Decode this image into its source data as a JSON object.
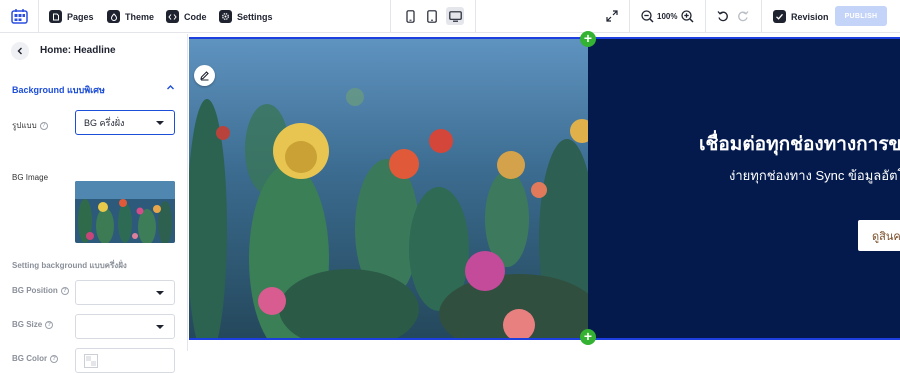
{
  "toolbar": {
    "pages_label": "Pages",
    "theme_label": "Theme",
    "code_label": "Code",
    "settings_label": "Settings",
    "zoom": "100%",
    "revision_label": "Revision",
    "publish_label": "PUBLISH",
    "icons": [
      "app-logo-icon",
      "pages-icon",
      "theme-icon",
      "code-icon",
      "settings-icon",
      "mobile-icon",
      "tablet-icon",
      "desktop-icon",
      "expand-icon",
      "zoom-out-icon",
      "zoom-in-icon",
      "undo-icon",
      "redo-icon",
      "revision-icon"
    ]
  },
  "panel": {
    "title": "Home: Headline",
    "section_title": "Background แบบพิเศษ",
    "pattern_label": "รูปแบบ",
    "pattern_value": "BG ครึ่งฝั่ง",
    "bg_image_label": "BG Image",
    "setting_title": "Setting background แบบครึ่งฝั่ง",
    "bg_position_label": "BG Position",
    "bg_size_label": "BG Size",
    "bg_color_label": "BG Color"
  },
  "hero": {
    "title": "เชื่อมต่อทุกช่องทางการข",
    "subtitle": "ง่ายทุกช่องทาง Sync ข้อมูลอัตโ",
    "cta": "ดูสินค",
    "colors": {
      "background": "#041a4d",
      "accent": "#1d3fe0",
      "add": "#34b232"
    }
  }
}
